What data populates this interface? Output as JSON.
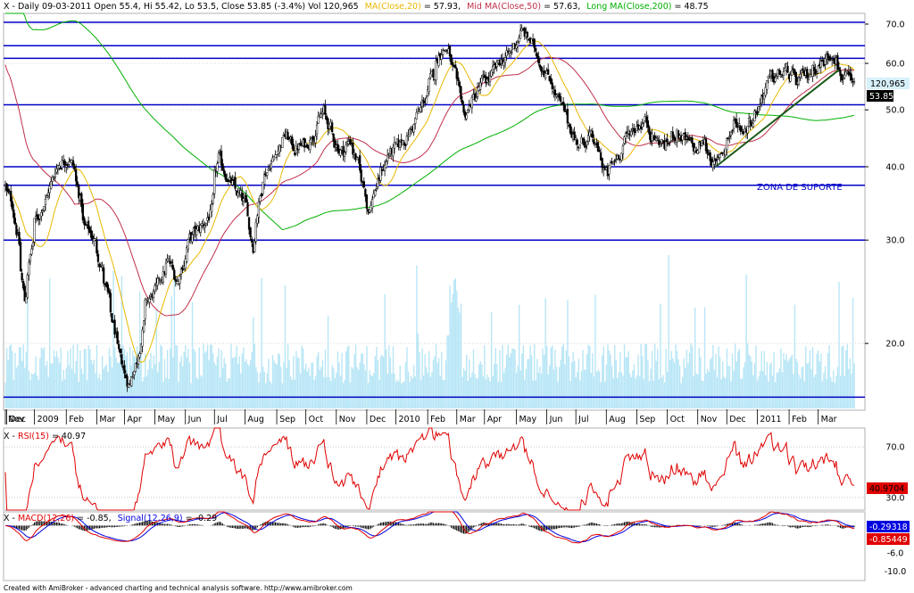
{
  "header": {
    "title_prefix": "X - Daily 09-03-2011 Open 55.4, Hi 55.42, Lo 53.5, Close 53.85 (-3.4%) Vol 120,965",
    "ma20_label": "MA(Close,20)",
    "ma20_value": " = 57.93,",
    "ma50_label": "Mid MA(Close,50)",
    "ma50_value": " = 57.63,",
    "ma200_label": "Long MA(Close,200)",
    "ma200_value": " = 48.75"
  },
  "footer": {
    "credit": "Created with AmiBroker - advanced charting and technical analysis software. http://www.amibroker.com"
  },
  "colors": {
    "candle": "#000000",
    "volume": "#b8e6f6",
    "ma20": "#e8b800",
    "ma50": "#c0304a",
    "ma200": "#00b000",
    "level_line": "#0000c8",
    "trend_line": "#1a5a1a",
    "rsi": "#e00000",
    "macd": "#e00000",
    "signal": "#0000e0"
  },
  "chart_data": [
    {
      "type": "candlestick",
      "title": "X - Daily",
      "scale": "log",
      "ylim": [
        15.5,
        73
      ],
      "y_ticks": [
        70.0,
        60.0,
        50.0,
        40.0,
        30.0,
        20.0
      ],
      "x_ticks": [
        "Nov",
        "Dec",
        "2009",
        "Feb",
        "Mar",
        "Apr",
        "May",
        "Jun",
        "Jul",
        "Aug",
        "Sep",
        "Oct",
        "Nov",
        "Dec",
        "2010",
        "Feb",
        "Mar",
        "Apr",
        "May",
        "Jun",
        "Jul",
        "Aug",
        "Sep",
        "Oct",
        "Nov",
        "Dec",
        "2011",
        "Feb",
        "Mar"
      ],
      "last_close": "53.85",
      "last_volume": "120,965",
      "horizontal_levels": [
        70.5,
        64.3,
        61.2,
        51.0,
        40.0,
        37.2,
        30.0,
        16.2
      ],
      "annotation": "ZONA DE SUPORTE",
      "price_anchors": [
        [
          "2008-10-31",
          37.0
        ],
        [
          "2008-11-10",
          33.5
        ],
        [
          "2008-11-20",
          23.5
        ],
        [
          "2008-12-01",
          32.0
        ],
        [
          "2008-12-15",
          36.5
        ],
        [
          "2008-12-24",
          40.5
        ],
        [
          "2009-01-05",
          42.0
        ],
        [
          "2009-01-12",
          37.5
        ],
        [
          "2009-01-20",
          31.5
        ],
        [
          "2009-01-28",
          30.5
        ],
        [
          "2009-02-05",
          27.5
        ],
        [
          "2009-02-15",
          22.5
        ],
        [
          "2009-02-25",
          18.5
        ],
        [
          "2009-03-06",
          17.0
        ],
        [
          "2009-03-16",
          19.5
        ],
        [
          "2009-03-24",
          23.5
        ],
        [
          "2009-04-02",
          24.5
        ],
        [
          "2009-04-14",
          27.5
        ],
        [
          "2009-04-24",
          25.5
        ],
        [
          "2009-05-06",
          30.0
        ],
        [
          "2009-05-18",
          31.5
        ],
        [
          "2009-05-28",
          33.5
        ],
        [
          "2009-06-04",
          41.0
        ],
        [
          "2009-06-12",
          39.0
        ],
        [
          "2009-06-22",
          36.0
        ],
        [
          "2009-07-01",
          34.5
        ],
        [
          "2009-07-09",
          29.5
        ],
        [
          "2009-07-20",
          39.0
        ],
        [
          "2009-07-30",
          41.5
        ],
        [
          "2009-08-10",
          45.5
        ],
        [
          "2009-08-20",
          43.0
        ],
        [
          "2009-08-31",
          43.5
        ],
        [
          "2009-09-10",
          46.5
        ],
        [
          "2009-09-18",
          49.5
        ],
        [
          "2009-09-30",
          44.0
        ],
        [
          "2009-10-08",
          42.5
        ],
        [
          "2009-10-16",
          44.5
        ],
        [
          "2009-10-26",
          38.5
        ],
        [
          "2009-11-03",
          34.0
        ],
        [
          "2009-11-12",
          37.5
        ],
        [
          "2009-11-23",
          42.0
        ],
        [
          "2009-12-03",
          43.0
        ],
        [
          "2009-12-15",
          46.0
        ],
        [
          "2009-12-28",
          51.0
        ],
        [
          "2010-01-08",
          57.5
        ],
        [
          "2010-01-15",
          64.0
        ],
        [
          "2010-01-22",
          63.5
        ],
        [
          "2010-02-01",
          54.0
        ],
        [
          "2010-02-08",
          49.0
        ],
        [
          "2010-02-18",
          52.5
        ],
        [
          "2010-02-26",
          55.5
        ],
        [
          "2010-03-08",
          57.0
        ],
        [
          "2010-03-18",
          61.0
        ],
        [
          "2010-03-26",
          62.0
        ],
        [
          "2010-04-06",
          68.0
        ],
        [
          "2010-04-15",
          65.5
        ],
        [
          "2010-04-26",
          60.5
        ],
        [
          "2010-05-06",
          56.5
        ],
        [
          "2010-05-14",
          51.5
        ],
        [
          "2010-05-25",
          47.0
        ],
        [
          "2010-06-04",
          43.5
        ],
        [
          "2010-06-14",
          45.0
        ],
        [
          "2010-06-24",
          42.0
        ],
        [
          "2010-07-02",
          38.5
        ],
        [
          "2010-07-12",
          41.5
        ],
        [
          "2010-07-22",
          45.0
        ],
        [
          "2010-08-02",
          47.5
        ],
        [
          "2010-08-10",
          48.0
        ],
        [
          "2010-08-20",
          44.5
        ],
        [
          "2010-08-31",
          43.5
        ],
        [
          "2010-09-10",
          46.0
        ],
        [
          "2010-09-20",
          44.0
        ],
        [
          "2010-09-30",
          42.5
        ],
        [
          "2010-10-08",
          44.0
        ],
        [
          "2010-10-20",
          40.0
        ],
        [
          "2010-10-28",
          43.0
        ],
        [
          "2010-11-08",
          47.5
        ],
        [
          "2010-11-18",
          46.5
        ],
        [
          "2010-11-30",
          50.0
        ],
        [
          "2010-12-10",
          55.0
        ],
        [
          "2010-12-20",
          57.0
        ],
        [
          "2010-12-31",
          58.0
        ],
        [
          "2011-01-10",
          55.5
        ],
        [
          "2011-01-20",
          57.0
        ],
        [
          "2011-01-28",
          59.5
        ],
        [
          "2011-02-07",
          60.5
        ],
        [
          "2011-02-16",
          63.5
        ],
        [
          "2011-02-24",
          57.5
        ],
        [
          "2011-03-04",
          55.4
        ],
        [
          "2011-03-09",
          53.85
        ]
      ]
    },
    {
      "type": "line",
      "title": "X - RSI(15)",
      "value_label": "RSI(15)",
      "value": "40.97",
      "last_value_badge": "40.9704",
      "y_ticks": [
        70.0,
        30.0
      ],
      "ylim": [
        20,
        85
      ],
      "series": [
        {
          "name": "RSI(15)"
        }
      ]
    },
    {
      "type": "line",
      "title": "X - MACD(12,26)",
      "macd_label": "MACD(12,26)",
      "macd_value": " = -0.85,",
      "signal_label": "Signal(12,26,9)",
      "signal_value": " = -0.29",
      "last_signal_badge": "-0.29318",
      "last_macd_badge": "-0.85449",
      "y_ticks": [
        -6.0,
        -10.0
      ],
      "ylim": [
        -12,
        3
      ],
      "series": [
        {
          "name": "MACD(12,26)"
        },
        {
          "name": "Signal(12,26,9)"
        }
      ]
    }
  ]
}
